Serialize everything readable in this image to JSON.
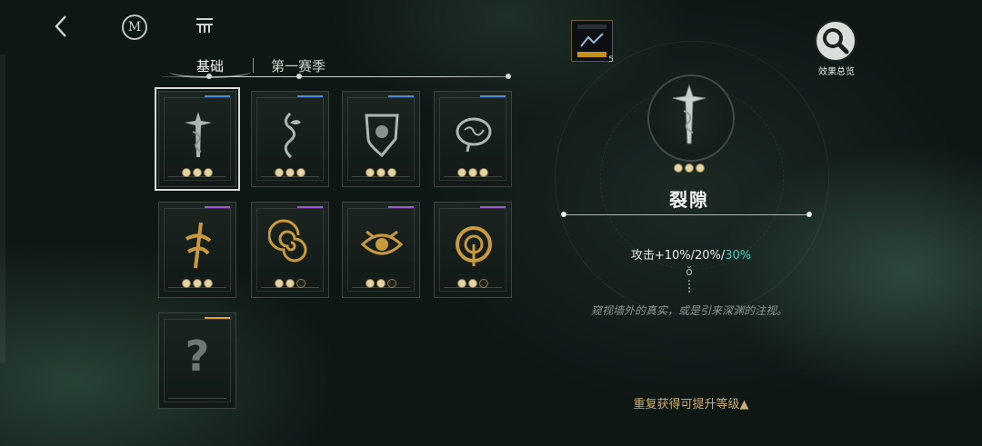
{
  "tabs": [
    {
      "label": "基础",
      "active": true
    },
    {
      "label": "第一赛季",
      "active": false
    }
  ],
  "cards": [
    {
      "emblem": "sword-icon",
      "tier_color": "#4a8ad6",
      "pips": [
        1,
        1,
        1
      ],
      "selected": true
    },
    {
      "emblem": "vine-icon",
      "tier_color": "#4a8ad6",
      "pips": [
        1,
        1,
        1
      ]
    },
    {
      "emblem": "shield-icon",
      "tier_color": "#4a8ad6",
      "pips": [
        1,
        1,
        1
      ]
    },
    {
      "emblem": "brain-icon",
      "tier_color": "#4a8ad6",
      "pips": [
        1,
        1,
        1
      ]
    },
    {
      "emblem": "rune-icon",
      "tier_color": "#9b5ad1",
      "pips": [
        1,
        1,
        1
      ]
    },
    {
      "emblem": "spiral-icon",
      "tier_color": "#9b5ad1",
      "pips": [
        1,
        1,
        0
      ]
    },
    {
      "emblem": "eye-icon",
      "tier_color": "#9b5ad1",
      "pips": [
        1,
        1,
        0
      ]
    },
    {
      "emblem": "ring-icon",
      "tier_color": "#9b5ad1",
      "pips": [
        1,
        1,
        0
      ]
    },
    {
      "emblem": "question-icon",
      "tier_color": "#d6a33c",
      "pips": [],
      "unknown_mark": "?"
    }
  ],
  "detail": {
    "title": "裂隙",
    "stat_prefix": "攻击+10%/20%/",
    "stat_highlight": "30%",
    "stat_symbol": "ŏ",
    "flavor": "窥视墙外的真实，或是引来深渊的注视。",
    "upgrade_hint": "重复获得可提升等级▲"
  },
  "top_right": {
    "thumb_count": "5",
    "effects_label": "效果总览"
  },
  "colors": {
    "accent_highlight": "#3fd0c2",
    "upgrade_text": "#c8ac74",
    "blue_tier": "#4a8ad6",
    "purple_tier": "#9b5ad1",
    "gold_tier": "#d6a33c"
  }
}
